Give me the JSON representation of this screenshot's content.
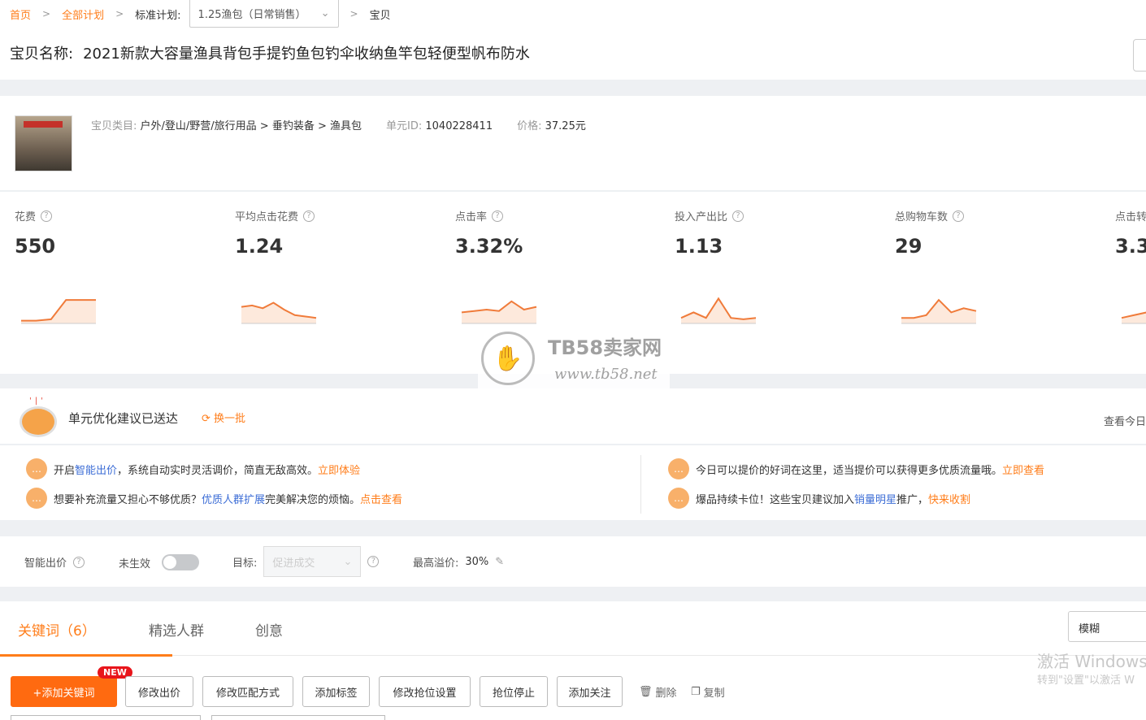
{
  "breadcrumb": {
    "home": "首页",
    "all_plans": "全部计划",
    "plan_label": "标准计划:",
    "plan_value": "1.25渔包（日常销售）",
    "current": "宝贝"
  },
  "item": {
    "name_label": "宝贝名称:",
    "name": "2021新款大容量渔具背包手提钓鱼包钓伞收纳鱼竿包轻便型帆布防水",
    "category_label": "宝贝类目:",
    "category": "户外/登山/野营/旅行用品 > 垂钓装备 > 渔具包",
    "unit_id_label": "单元ID:",
    "unit_id": "1040228411",
    "price_label": "价格:",
    "price": "37.25元"
  },
  "metrics": [
    {
      "label": "花费",
      "value": "550",
      "trend": [
        0.1,
        0.1,
        0.15,
        0.85,
        0.85,
        0.85
      ]
    },
    {
      "label": "平均点击花费",
      "value": "1.24",
      "trend": [
        0.6,
        0.65,
        0.55,
        0.75,
        0.5,
        0.3,
        0.25,
        0.2
      ]
    },
    {
      "label": "点击率",
      "value": "3.32%",
      "trend": [
        0.4,
        0.45,
        0.5,
        0.45,
        0.8,
        0.5,
        0.6
      ]
    },
    {
      "label": "投入产出比",
      "value": "1.13",
      "trend": [
        0.2,
        0.4,
        0.2,
        0.9,
        0.2,
        0.15,
        0.2
      ]
    },
    {
      "label": "总购物车数",
      "value": "29",
      "trend": [
        0.2,
        0.2,
        0.3,
        0.85,
        0.4,
        0.55,
        0.45
      ]
    },
    {
      "label": "点击转",
      "value": "3.3",
      "trend": [
        0.2,
        0.5,
        0.3
      ]
    }
  ],
  "watermark": {
    "title": "TB58卖家网",
    "url": "www.tb58.net"
  },
  "suggestions": {
    "title": "单元优化建议已送达",
    "refresh": "换一批",
    "see_today": "查看今日",
    "tips": [
      {
        "pre": "开启",
        "link": "智能出价",
        "mid": "，系统自动实时灵活调价，简直无敌高效。",
        "action": "立即体验"
      },
      {
        "pre": "想要补充流量又担心不够优质？",
        "link": "优质人群扩展",
        "mid": "完美解决您的烦恼。",
        "action": "点击查看"
      },
      {
        "pre": "今日可以提价的好词在这里，适当提价可以获得更多优质流量哦。",
        "link": "",
        "mid": "",
        "action": "立即查看"
      },
      {
        "pre": "爆品持续卡位！这些宝贝建议加入",
        "link": "销量明星",
        "mid": "推广，",
        "action": "快来收割"
      }
    ]
  },
  "smart_bid": {
    "label": "智能出价",
    "status": "未生效",
    "goal_label": "目标:",
    "goal_value": "促进成交",
    "max_premium_label": "最高溢价:",
    "max_premium_value": "30%"
  },
  "tabs": [
    {
      "label": "关键词（6）",
      "active": true
    },
    {
      "label": "精选人群",
      "active": false
    },
    {
      "label": "创意",
      "active": false
    }
  ],
  "match_mode": "模糊",
  "windows_watermark": {
    "line1": "激活 Windows",
    "line2": "转到\"设置\"以激活 W"
  },
  "actions": {
    "new_badge": "NEW",
    "add_keyword": "+添加关键词",
    "modify_bid": "修改出价",
    "modify_match": "修改匹配方式",
    "add_tag": "添加标签",
    "modify_rank": "修改抢位设置",
    "stop_rank": "抢位停止",
    "add_follow": "添加关注",
    "delete": "删除",
    "copy": "复制"
  },
  "colors": {
    "accent": "#ff7d1a",
    "link": "#3c6dd6",
    "trend_line": "#f07b3a"
  }
}
